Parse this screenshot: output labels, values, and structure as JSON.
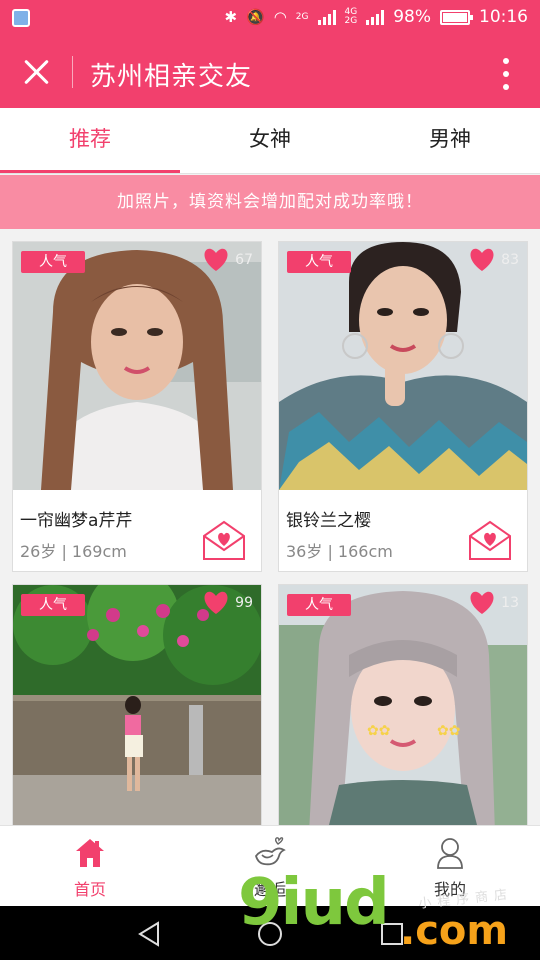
{
  "status_bar": {
    "network": "4G",
    "network_sub": "2G",
    "wifi_sub": "2G",
    "battery": "98%",
    "time": "10:16",
    "icons": [
      "app-icon",
      "bluetooth-icon",
      "mute-icon",
      "wifi-icon",
      "signal-icon",
      "battery-icon"
    ]
  },
  "header": {
    "title": "苏州相亲交友",
    "close_icon": "close-icon",
    "more_icon": "more-vertical-icon"
  },
  "tabs": [
    {
      "label": "推荐",
      "active": true
    },
    {
      "label": "女神",
      "active": false
    },
    {
      "label": "男神",
      "active": false
    }
  ],
  "banner": {
    "text": "加照片，填资料会增加配对成功率哦！"
  },
  "cards": [
    {
      "badge": "人气",
      "likes": "67",
      "name": "一帘幽梦a芹芹",
      "info": "26岁 | 169cm"
    },
    {
      "badge": "人气",
      "likes": "83",
      "name": "银铃兰之樱",
      "info": "36岁 | 166cm"
    },
    {
      "badge": "人气",
      "likes": "99",
      "name": "",
      "info": ""
    },
    {
      "badge": "人气",
      "likes": "13",
      "name": "",
      "info": ""
    }
  ],
  "bottom_nav": [
    {
      "label": "首页",
      "icon": "home-icon",
      "active": true
    },
    {
      "label": "邂逅",
      "icon": "bird-icon",
      "active": false
    },
    {
      "label": "我的",
      "icon": "profile-icon",
      "active": false
    }
  ],
  "watermark": {
    "text": "9iud",
    "domain": ".com",
    "small": "小程序商店"
  },
  "colors": {
    "accent": "#f2406d",
    "banner": "#f98ca3",
    "watermark_green": "#7ec83d",
    "watermark_orange": "#f6a21a"
  }
}
